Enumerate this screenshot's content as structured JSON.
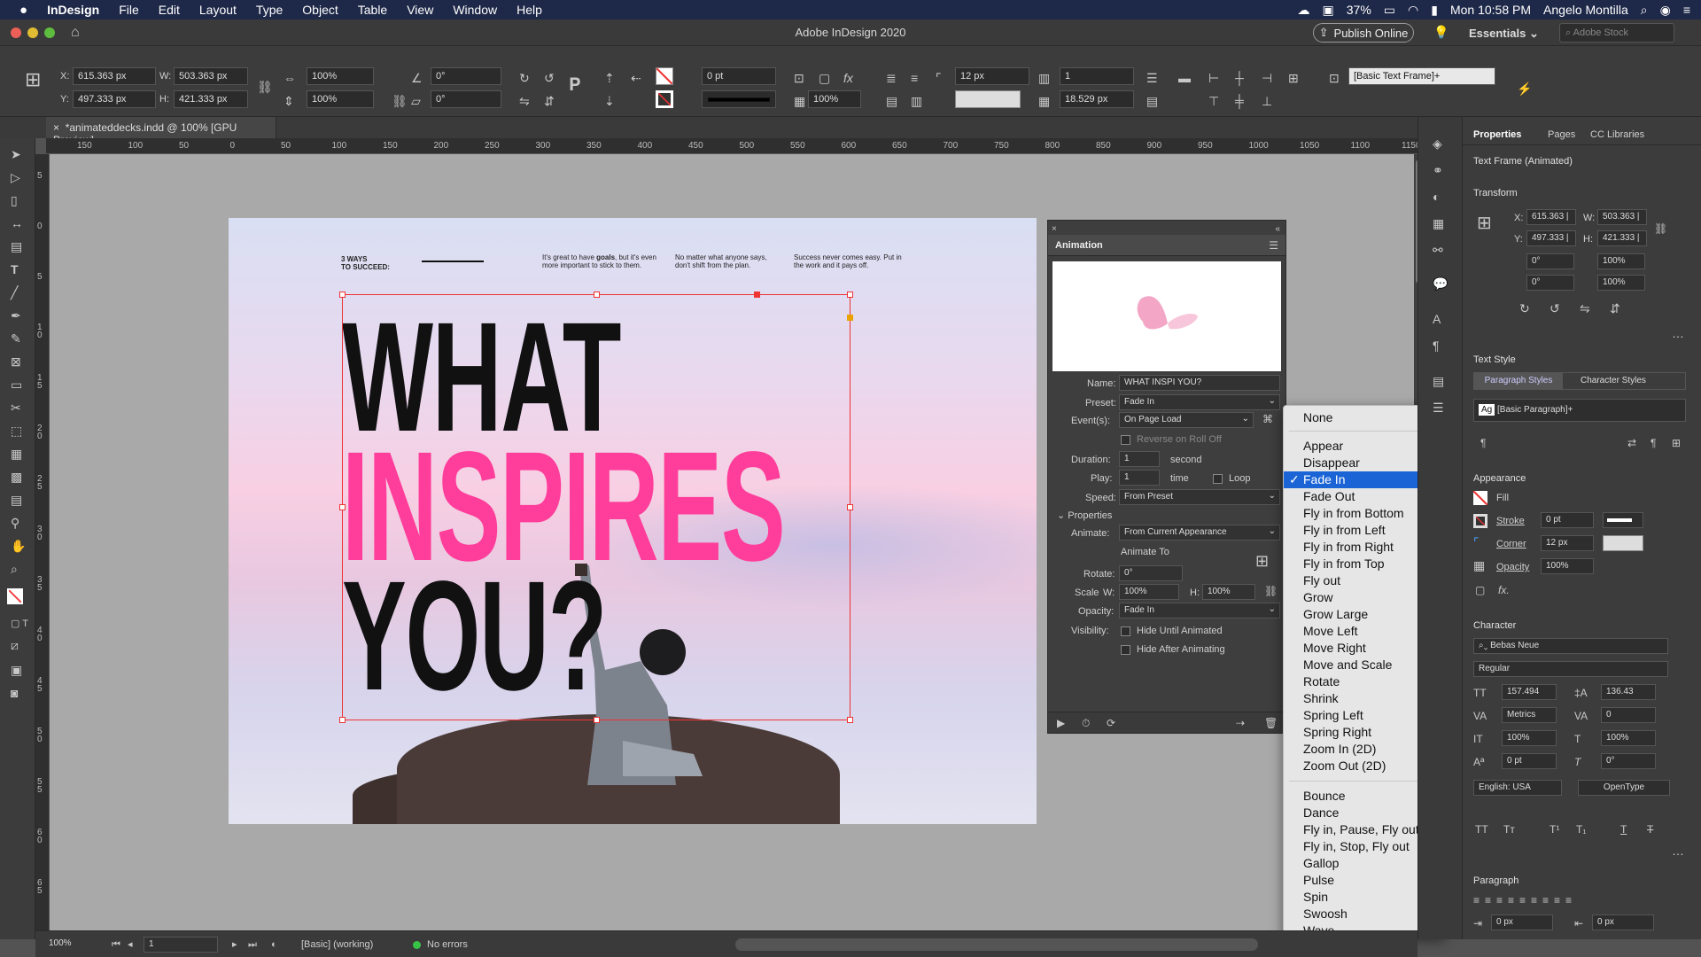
{
  "menubar": {
    "apple": "",
    "app": "InDesign",
    "items": [
      "File",
      "Edit",
      "Layout",
      "Type",
      "Object",
      "Table",
      "View",
      "Window",
      "Help"
    ],
    "battery": "37%",
    "clock": "Mon 10:58 PM",
    "user": "Angelo Montilla"
  },
  "titlebar": {
    "title": "Adobe InDesign 2020",
    "publish": "Publish Online",
    "workspace": "Essentials",
    "stock_placeholder": "Adobe Stock"
  },
  "control": {
    "x_label": "X:",
    "x": "615.363 px",
    "y_label": "Y:",
    "y": "497.333 px",
    "w_label": "W:",
    "w": "503.363 px",
    "h_label": "H:",
    "h": "421.333 px",
    "scale_x": "100%",
    "scale_y": "100%",
    "angle": "0°",
    "shear": "0°",
    "stroke_weight": "0 pt",
    "opacity": "100%",
    "corner": "12 px",
    "columns": "1",
    "gutter": "18.529 px",
    "frame_style": "[Basic Text Frame]+"
  },
  "doc": {
    "tab": "*animateddecks.indd @ 100% [GPU Preview]",
    "ruler_h": [
      "150",
      "100",
      "50",
      "0",
      "50",
      "100",
      "150",
      "200",
      "250",
      "300",
      "350",
      "400",
      "450",
      "500",
      "550",
      "600",
      "650",
      "700",
      "750",
      "800",
      "850",
      "900",
      "950",
      "1000",
      "1050",
      "1100",
      "1150"
    ],
    "ruler_v": [
      "5",
      "0",
      "5",
      "1 0",
      "1 5",
      "2 0",
      "2 5",
      "3 0",
      "3 5",
      "4 0",
      "4 5",
      "5 0",
      "5 5",
      "6 0",
      "6 5"
    ]
  },
  "page": {
    "ways_line1": "3 WAYS",
    "ways_line2": "TO SUCCEED:",
    "col1_pre": "It's great to have ",
    "col1_bold": "goals",
    "col1_post": ", but it's even more important to stick to them.",
    "col2": "No matter what anyone says, don't shift from the plan.",
    "col3": "Success never comes easy. Put in the work and it pays off.",
    "word1": "WHAT",
    "word2": "INSPIRES",
    "word3": "YOU?"
  },
  "animation": {
    "title": "Animation",
    "name_label": "Name:",
    "name": "WHAT INSPI YOU?",
    "preset_label": "Preset:",
    "preset": "Fade In",
    "events_label": "Event(s):",
    "events": "On Page Load",
    "reverse": "Reverse on Roll Off",
    "duration_label": "Duration:",
    "duration": "1",
    "duration_unit": "second",
    "play_label": "Play:",
    "play": "1",
    "play_unit": "time",
    "loop": "Loop",
    "speed_label": "Speed:",
    "speed": "From Preset",
    "properties": "Properties",
    "animate_label": "Animate:",
    "animate": "From Current Appearance",
    "animate_to": "Animate To",
    "rotate_label": "Rotate:",
    "rotate": "0°",
    "scale_label": "Scale",
    "scale_w_label": "W:",
    "scale_w": "100%",
    "scale_h_label": "H:",
    "scale_h": "100%",
    "opacity_label": "Opacity:",
    "opacity": "Fade In",
    "visibility_label": "Visibility:",
    "hide_until": "Hide Until Animated",
    "hide_after": "Hide After Animating"
  },
  "dropdown": {
    "none": "None",
    "group1": [
      "Appear",
      "Disappear",
      "Fade In",
      "Fade Out",
      "Fly in from Bottom",
      "Fly in from Left",
      "Fly in from Right",
      "Fly in from Top",
      "Fly out",
      "Grow",
      "Grow Large",
      "Move Left",
      "Move Right",
      "Move and Scale",
      "Rotate",
      "Shrink",
      "Spring Left",
      "Spring Right",
      "Zoom In (2D)",
      "Zoom Out (2D)"
    ],
    "group2": [
      "Bounce",
      "Dance",
      "Fly in, Pause, Fly out",
      "Fly in, Stop, Fly out",
      "Gallop",
      "Pulse",
      "Spin",
      "Swoosh",
      "Wave"
    ],
    "checked": "Fade In",
    "check_mark": "✓"
  },
  "properties": {
    "tabs": [
      "Properties",
      "Pages",
      "CC Libraries"
    ],
    "subtitle": "Text Frame (Animated)",
    "transform": "Transform",
    "x_label": "X:",
    "x": "615.363 |",
    "w_label": "W:",
    "w": "503.363 |",
    "y_label": "Y:",
    "y": "497.333 |",
    "h_label": "H:",
    "h": "421.333 |",
    "rot": "0°",
    "scale_x": "100%",
    "shear": "0°",
    "scale_y": "100%",
    "text_style": "Text Style",
    "para_styles": "Paragraph Styles",
    "char_styles": "Character Styles",
    "para_style_value": "[Basic Paragraph]+",
    "appearance": "Appearance",
    "fill": "Fill",
    "stroke": "Stroke",
    "stroke_value": "0 pt",
    "corner": "Corner",
    "corner_value": "12 px",
    "opacity": "Opacity",
    "opacity_value": "100%",
    "character": "Character",
    "font": "Bebas Neue",
    "style": "Regular",
    "size": "157.494",
    "leading": "136.43",
    "kerning": "Metrics",
    "tracking": "0",
    "vscale": "100%",
    "hscale": "100%",
    "baseline": "0 pt",
    "skew": "0°",
    "language": "English: USA",
    "opentype": "OpenType",
    "paragraph": "Paragraph",
    "indent_left": "0 px",
    "indent_right": "0 px"
  },
  "status": {
    "zoom": "100%",
    "page": "1",
    "style": "[Basic] (working)",
    "errors": "No errors"
  },
  "colors": {
    "pink": "#ff3d9a",
    "selection": "#e33333",
    "menu_highlight": "#1b64d6"
  }
}
